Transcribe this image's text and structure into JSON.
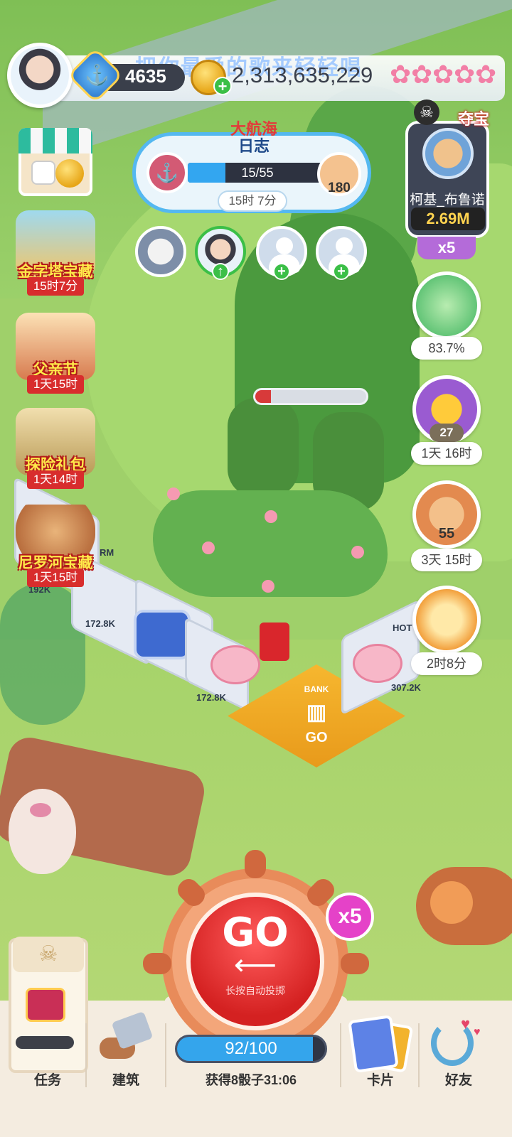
{
  "top_bar": {
    "anchor_level": "4635",
    "coins": "2,313,635,229",
    "lyric_overlay": "把你最爱的歌来轻轻唱"
  },
  "treasure": {
    "title": "夺宝",
    "player_name": "柯基_布鲁诺",
    "amount": "2.69M",
    "multiplier": "x5"
  },
  "voyage_log": {
    "title_line1": "大航海",
    "title_line2": "日志",
    "progress_text": "15/55",
    "progress_fraction": 0.27,
    "plank_count": "180",
    "timer": "15时 7分"
  },
  "left_events": [
    {
      "name": "金字塔宝藏",
      "timer": "15时7分"
    },
    {
      "name": "父亲节",
      "timer": "1天15时"
    },
    {
      "name": "探险礼包",
      "timer": "1天14时"
    },
    {
      "name": "尼罗河宝藏",
      "timer": "1天15时"
    }
  ],
  "right_items": {
    "dino_progress": "83.7%",
    "mango_count": "27",
    "mango_timer": "1天 16时",
    "plank_count": "55",
    "plank_timer": "3天 15时",
    "firework_timer": "2时8分"
  },
  "board": {
    "price_1": "172.8K",
    "price_2": "172.8K",
    "price_3": "307.2K",
    "price_4": "192K",
    "bank_label": "BANK",
    "go_label": "GO",
    "farm_label": "RM",
    "hotel_label": "HOT"
  },
  "roll": {
    "go_label": "GO",
    "arrow": "⟵",
    "hint": "长按自动投掷",
    "multiplier": "x5",
    "dice_text": "92/100",
    "dice_fraction": 0.92,
    "refill_text": "获得8骰子31:06"
  },
  "nav": {
    "tasks": "任务",
    "build": "建筑",
    "cards": "卡片",
    "friends": "好友"
  },
  "colors": {
    "accent_blue": "#34a5ec",
    "go_red": "#d42121",
    "event_red": "#d82d2d",
    "x5_magenta": "#e542c8"
  }
}
